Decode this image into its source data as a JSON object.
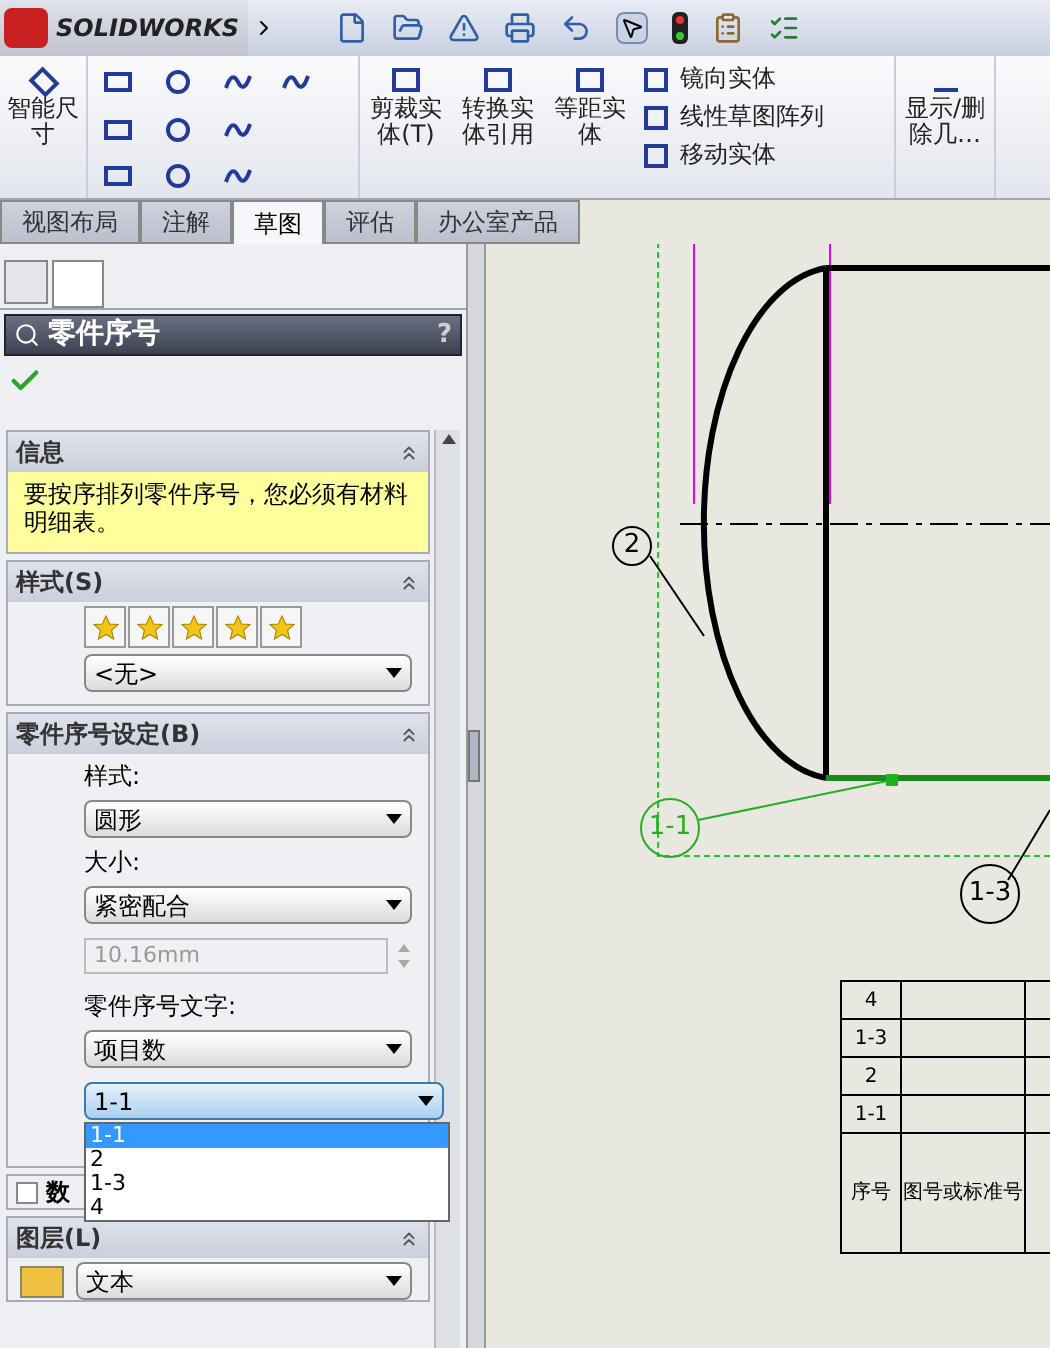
{
  "app": {
    "logo": "SOLIDWORKS"
  },
  "ribbon": {
    "large_buttons": [
      {
        "label": "智能尺寸"
      },
      {
        "label": "剪裁实体(T)"
      },
      {
        "label": "转换实体引用"
      },
      {
        "label": "等距实体"
      }
    ],
    "small_buttons": [
      {
        "label": "镜向实体"
      },
      {
        "label": "线性草图阵列"
      },
      {
        "label": "移动实体"
      }
    ],
    "display_button": {
      "label": "显示/删除几…"
    }
  },
  "tabs": [
    {
      "label": "视图布局",
      "selected": false
    },
    {
      "label": "注解",
      "selected": false
    },
    {
      "label": "草图",
      "selected": true
    },
    {
      "label": "评估",
      "selected": false
    },
    {
      "label": "办公室产品",
      "selected": false
    }
  ],
  "panel": {
    "title": "零件序号",
    "help": "?",
    "info": {
      "title": "信息",
      "message": "要按序排列零件序号，您必须有材料明细表。"
    },
    "style": {
      "title": "样式(S)",
      "value": "<无>"
    },
    "settings": {
      "title": "零件序号设定(B)",
      "style_label": "样式:",
      "style_value": "圆形",
      "size_label": "大小:",
      "size_value": "紧密配合",
      "size_field": "10.16mm",
      "text_label": "零件序号文字:",
      "text_value": "项目数",
      "item_value": "1-1",
      "options": [
        {
          "label": "1-1",
          "selected": true
        },
        {
          "label": "2",
          "selected": false
        },
        {
          "label": "1-3",
          "selected": false
        },
        {
          "label": "4",
          "selected": false
        }
      ]
    },
    "checkbox": {
      "label": "数",
      "checked": false
    },
    "layer": {
      "title": "图层(L)",
      "value": "文本"
    }
  },
  "drawing": {
    "balloons": [
      {
        "label": "2",
        "selected": false
      },
      {
        "label": "1-1",
        "selected": true
      },
      {
        "label": "1-3",
        "selected": false
      }
    ],
    "table": {
      "rows": [
        [
          "4",
          ""
        ],
        [
          "1-3",
          ""
        ],
        [
          "2",
          ""
        ],
        [
          "1-1",
          ""
        ]
      ],
      "header": [
        "序号",
        "图号或标准号"
      ]
    }
  }
}
